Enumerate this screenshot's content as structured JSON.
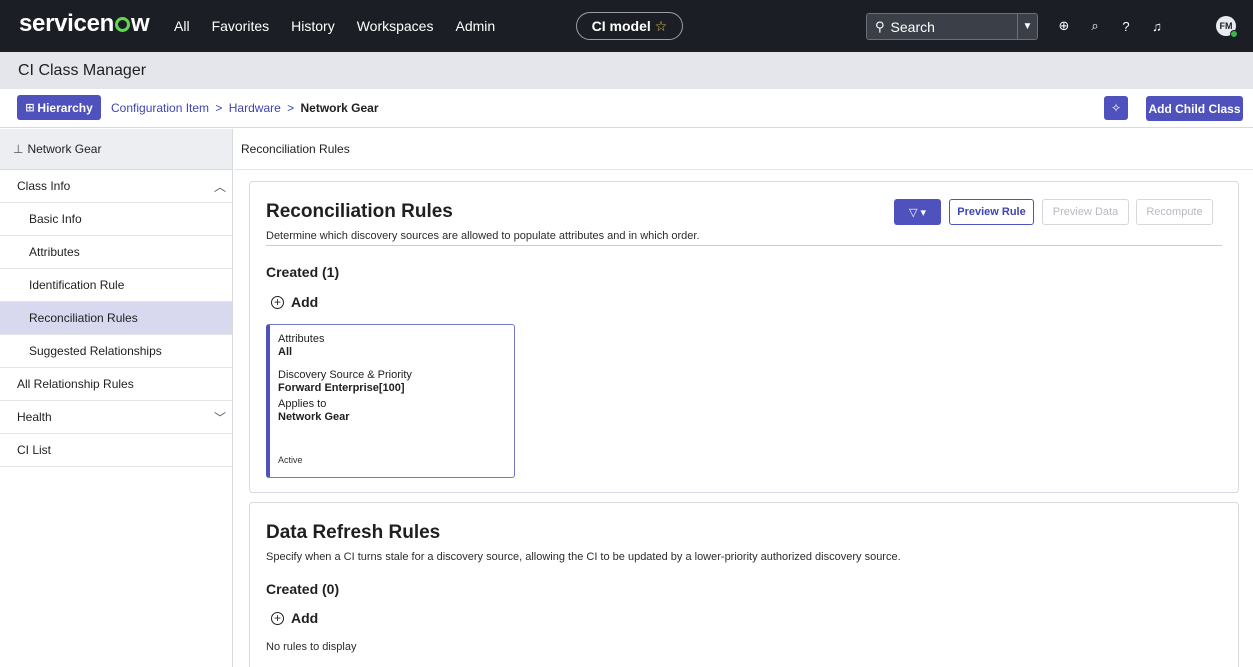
{
  "topnav": {
    "logo_pre": "servicen",
    "logo_post": "w",
    "links": [
      "All",
      "Favorites",
      "History",
      "Workspaces",
      "Admin"
    ],
    "context_pill": "CI model",
    "search_label": "Search",
    "avatar_initials": "FM"
  },
  "app": {
    "title": "CI Class Manager"
  },
  "crumbbar": {
    "hierarchy_label": "Hierarchy",
    "crumb1": "Configuration Item",
    "crumb2": "Hardware",
    "separator": ">",
    "current": "Network Gear",
    "add_child_label": "Add Child Class"
  },
  "sidebar": {
    "header": "Network Gear",
    "items": [
      {
        "label": "Class Info",
        "level": 0,
        "chevron": "up"
      },
      {
        "label": "Basic Info",
        "level": 1
      },
      {
        "label": "Attributes",
        "level": 1
      },
      {
        "label": "Identification Rule",
        "level": 1
      },
      {
        "label": "Reconciliation Rules",
        "level": 1,
        "active": true
      },
      {
        "label": "Suggested Relationships",
        "level": 1
      },
      {
        "label": "All Relationship Rules",
        "level": 0
      },
      {
        "label": "Health",
        "level": 0,
        "chevron": "down"
      },
      {
        "label": "CI List",
        "level": 0
      }
    ]
  },
  "main": {
    "header": "Reconciliation Rules",
    "recon": {
      "title": "Reconciliation Rules",
      "description": "Determine which discovery sources are allowed to populate attributes and in which order.",
      "created": "Created (1)",
      "add_label": "Add",
      "preview_rule": "Preview Rule",
      "preview_data": "Preview Data",
      "recompute": "Recompute",
      "rule": {
        "attributes_label": "Attributes",
        "attributes_value": "All",
        "source_label": "Discovery Source & Priority",
        "source_value": "Forward Enterprise[100]",
        "applies_label": "Applies to",
        "applies_value": "Network Gear",
        "status": "Active"
      }
    },
    "refresh": {
      "title": "Data Refresh Rules",
      "description": "Specify when a CI turns stale for a discovery source, allowing the CI to be updated by a lower-priority authorized discovery source.",
      "created": "Created (0)",
      "add_label": "Add",
      "empty": "No rules to display"
    }
  },
  "colors": {
    "accent": "#4f52bd",
    "nav_bg": "#1b1e25",
    "logo_green": "#62d84e"
  }
}
